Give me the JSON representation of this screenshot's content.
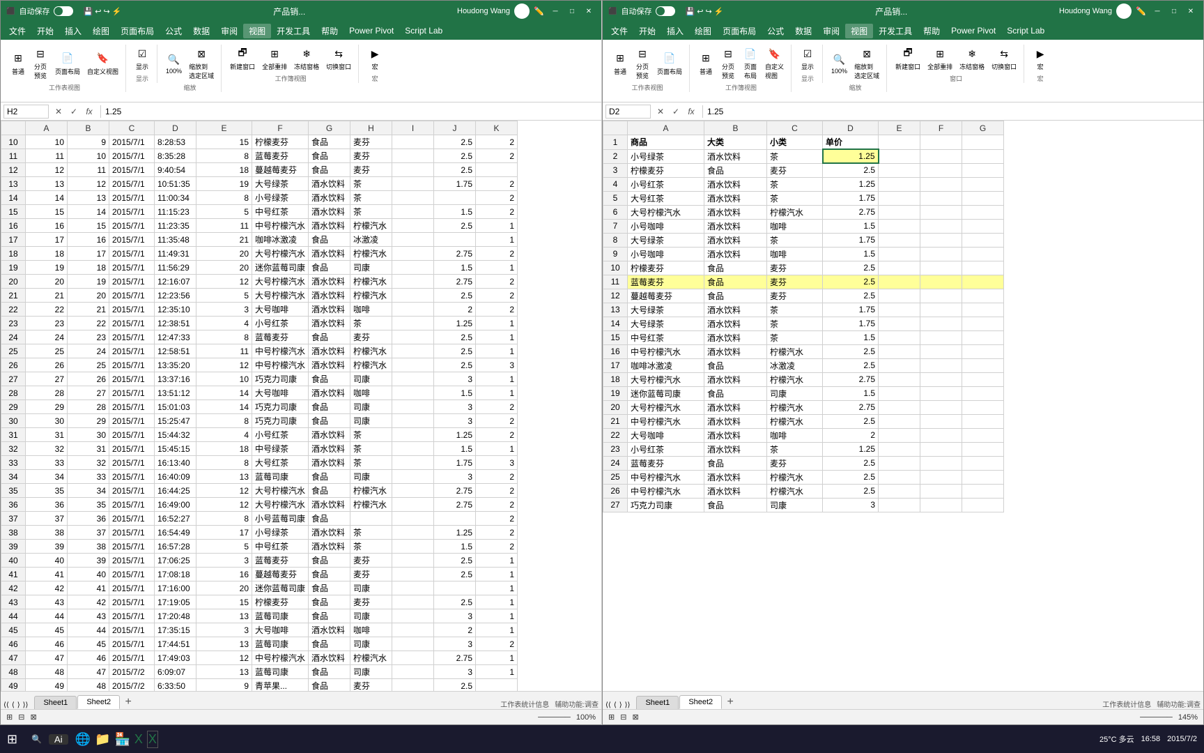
{
  "windows": [
    {
      "id": "left",
      "titleBar": {
        "autosave": "自动保存",
        "title": "产品销...",
        "user": "Houdong Wang",
        "controls": [
          "─",
          "□",
          "✕"
        ]
      },
      "menuItems": [
        "文件",
        "开始",
        "插入",
        "绘图",
        "页面布局",
        "公式",
        "数据",
        "审阅",
        "视图",
        "开发工具",
        "帮助",
        "Power Pivot",
        "Script Lab"
      ],
      "activeMenu": "视图",
      "ribbonGroups": [
        {
          "label": "工作表视图",
          "btns": [
            "普通",
            "分页预览",
            "页面布局",
            "自定义视图"
          ]
        },
        {
          "label": "显示",
          "btns": [
            "显示"
          ]
        },
        {
          "label": "缩放",
          "btns": [
            "100%",
            "缩放到选定区域"
          ]
        },
        {
          "label": "窗口",
          "btns": [
            "新建窗口",
            "全部重排",
            "冻结窗格",
            "切换窗口"
          ]
        },
        {
          "label": "宏",
          "btns": [
            "宏"
          ]
        }
      ],
      "formulaBar": {
        "cellRef": "H2",
        "formula": "1.25"
      },
      "columns": [
        "",
        "A",
        "B",
        "C",
        "D",
        "E",
        "F",
        "G",
        "H",
        "I",
        "J",
        "K"
      ],
      "rows": [
        [
          "10",
          "9",
          "2015/7/1",
          "8:28:53",
          "15",
          "柠檬麦芬",
          "食品",
          "",
          "麦芬",
          "",
          "2.5",
          "2"
        ],
        [
          "11",
          "10",
          "2015/7/1",
          "8:35:28",
          "8",
          "蓝莓麦芬",
          "食品",
          "",
          "麦芬",
          "",
          "2.5",
          "2"
        ],
        [
          "12",
          "11",
          "2015/7/1",
          "9:40:54",
          "18",
          "蔓越莓麦芬",
          "食品",
          "",
          "麦芬",
          "",
          "2.5",
          ""
        ],
        [
          "13",
          "12",
          "2015/7/1",
          "10:51:35",
          "19",
          "大号绿茶",
          "酒水饮料",
          "",
          "茶",
          "",
          "1.75",
          "2"
        ],
        [
          "14",
          "13",
          "2015/7/1",
          "11:00:34",
          "8",
          "小号绿茶",
          "酒水饮料",
          "",
          "茶",
          "",
          "",
          "2"
        ],
        [
          "15",
          "14",
          "2015/7/1",
          "11:15:23",
          "5",
          "中号红茶",
          "酒水饮料",
          "",
          "茶",
          "",
          "1.5",
          "2"
        ],
        [
          "16",
          "15",
          "2015/7/1",
          "11:23:35",
          "11",
          "中号柠檬汽水",
          "酒水饮料",
          "",
          "柠檬汽水",
          "",
          "2.5",
          "1"
        ],
        [
          "17",
          "16",
          "2015/7/1",
          "11:35:48",
          "21",
          "咖啡冰激凌",
          "食品",
          "",
          "冰激凌",
          "",
          "",
          "1"
        ],
        [
          "18",
          "17",
          "2015/7/1",
          "11:49:31",
          "20",
          "大号柠檬汽水",
          "酒水饮料",
          "",
          "柠檬汽水",
          "",
          "2.75",
          "2"
        ],
        [
          "19",
          "18",
          "2015/7/1",
          "11:56:29",
          "20",
          "迷你蓝莓司康",
          "食品",
          "",
          "司康",
          "",
          "1.5",
          "1"
        ],
        [
          "20",
          "19",
          "2015/7/1",
          "12:16:07",
          "12",
          "大号柠檬汽水",
          "酒水饮料",
          "",
          "柠檬汽水",
          "",
          "2.75",
          "2"
        ],
        [
          "21",
          "20",
          "2015/7/1",
          "12:23:56",
          "5",
          "大号柠檬汽水",
          "酒水饮料",
          "",
          "柠檬汽水",
          "",
          "2.5",
          "2"
        ],
        [
          "22",
          "21",
          "2015/7/1",
          "12:35:10",
          "3",
          "大号咖啡",
          "酒水饮料",
          "",
          "咖啡",
          "",
          "2",
          "2"
        ],
        [
          "23",
          "22",
          "2015/7/1",
          "12:38:51",
          "4",
          "小号红茶",
          "酒水饮料",
          "",
          "茶",
          "",
          "1.25",
          "1"
        ],
        [
          "24",
          "23",
          "2015/7/1",
          "12:47:33",
          "8",
          "蓝莓麦芬",
          "食品",
          "",
          "麦芬",
          "",
          "2.5",
          "1"
        ],
        [
          "25",
          "24",
          "2015/7/1",
          "12:58:51",
          "11",
          "中号柠檬汽水",
          "酒水饮料",
          "",
          "柠檬汽水",
          "",
          "2.5",
          "1"
        ],
        [
          "26",
          "25",
          "2015/7/1",
          "13:35:20",
          "12",
          "中号柠檬汽水",
          "酒水饮料",
          "",
          "柠檬汽水",
          "",
          "2.5",
          "3"
        ],
        [
          "27",
          "26",
          "2015/7/1",
          "13:37:16",
          "10",
          "巧克力司康",
          "食品",
          "",
          "司康",
          "",
          "3",
          "1"
        ],
        [
          "28",
          "27",
          "2015/7/1",
          "13:51:12",
          "14",
          "大号咖啡",
          "酒水饮料",
          "",
          "咖啡",
          "",
          "1.5",
          "1"
        ],
        [
          "29",
          "28",
          "2015/7/1",
          "15:01:03",
          "14",
          "巧克力司康",
          "食品",
          "",
          "司康",
          "",
          "3",
          "2"
        ],
        [
          "30",
          "29",
          "2015/7/1",
          "15:25:47",
          "8",
          "巧克力司康",
          "食品",
          "",
          "司康",
          "",
          "3",
          "2"
        ],
        [
          "31",
          "30",
          "2015/7/1",
          "15:44:32",
          "4",
          "小号红茶",
          "酒水饮料",
          "",
          "茶",
          "",
          "1.25",
          "2"
        ],
        [
          "32",
          "31",
          "2015/7/1",
          "15:45:15",
          "18",
          "中号绿茶",
          "酒水饮料",
          "",
          "茶",
          "",
          "1.5",
          "1"
        ],
        [
          "33",
          "32",
          "2015/7/1",
          "16:13:40",
          "8",
          "大号红茶",
          "酒水饮料",
          "",
          "茶",
          "",
          "1.75",
          "3"
        ],
        [
          "34",
          "33",
          "2015/7/1",
          "16:40:09",
          "13",
          "蓝莓司康",
          "食品",
          "",
          "司康",
          "",
          "3",
          "2"
        ],
        [
          "35",
          "34",
          "2015/7/1",
          "16:44:25",
          "12",
          "大号柠檬汽水",
          "食品",
          "",
          "柠檬汽水",
          "",
          "2.75",
          "2"
        ],
        [
          "36",
          "35",
          "2015/7/1",
          "16:49:00",
          "12",
          "大号柠檬汽水",
          "酒水饮料",
          "",
          "柠檬汽水",
          "",
          "2.75",
          "2"
        ],
        [
          "37",
          "36",
          "2015/7/1",
          "16:52:27",
          "8",
          "小号蓝莓司康",
          "食品",
          "",
          "",
          "",
          "",
          "2"
        ],
        [
          "38",
          "37",
          "2015/7/1",
          "16:54:49",
          "17",
          "小号绿茶",
          "酒水饮料",
          "",
          "茶",
          "",
          "1.25",
          "2"
        ],
        [
          "39",
          "38",
          "2015/7/1",
          "16:57:28",
          "5",
          "中号红茶",
          "酒水饮料",
          "",
          "茶",
          "",
          "1.5",
          "2"
        ],
        [
          "40",
          "39",
          "2015/7/1",
          "17:06:25",
          "3",
          "蓝莓麦芬",
          "食品",
          "",
          "麦芬",
          "",
          "2.5",
          "1"
        ],
        [
          "41",
          "40",
          "2015/7/1",
          "17:08:18",
          "16",
          "蔓越莓麦芬",
          "食品",
          "",
          "麦芬",
          "",
          "2.5",
          "1"
        ],
        [
          "42",
          "41",
          "2015/7/1",
          "17:16:00",
          "20",
          "迷你蓝莓司康",
          "食品",
          "",
          "司康",
          "",
          "",
          "1"
        ],
        [
          "43",
          "42",
          "2015/7/1",
          "17:19:05",
          "15",
          "柠檬麦芬",
          "食品",
          "",
          "麦芬",
          "",
          "2.5",
          "1"
        ],
        [
          "44",
          "43",
          "2015/7/1",
          "17:20:48",
          "13",
          "蓝莓司康",
          "食品",
          "",
          "司康",
          "",
          "3",
          "1"
        ],
        [
          "45",
          "44",
          "2015/7/1",
          "17:35:15",
          "3",
          "大号咖啡",
          "酒水饮料",
          "",
          "咖啡",
          "",
          "2",
          "1"
        ],
        [
          "46",
          "45",
          "2015/7/1",
          "17:44:51",
          "13",
          "蓝莓司康",
          "食品",
          "",
          "司康",
          "",
          "3",
          "2"
        ],
        [
          "47",
          "46",
          "2015/7/1",
          "17:49:03",
          "12",
          "中号柠檬汽水",
          "酒水饮料",
          "",
          "柠檬汽水",
          "",
          "2.75",
          "1"
        ],
        [
          "48",
          "47",
          "2015/7/2",
          "6:09:07",
          "13",
          "蓝莓司康",
          "食品",
          "",
          "司康",
          "",
          "3",
          "1"
        ],
        [
          "49",
          "48",
          "2015/7/2",
          "6:33:50",
          "9",
          "青苹果...",
          "食品",
          "",
          "麦芬",
          "",
          "2.5",
          ""
        ]
      ],
      "sheetTabs": [
        "Sheet1",
        "Sheet2"
      ],
      "activeSheet": "Sheet2",
      "statusLeft": "工作表统计信息",
      "statusRight": "辅助功能:调查",
      "zoom": "100%"
    },
    {
      "id": "right",
      "titleBar": {
        "autosave": "自动保存",
        "title": "产品销...",
        "user": "Houdong Wang",
        "controls": [
          "─",
          "□",
          "✕"
        ]
      },
      "menuItems": [
        "文件",
        "开始",
        "插入",
        "绘图",
        "页面布局",
        "公式",
        "数据",
        "审阅",
        "视图",
        "开发工具",
        "帮助",
        "Power Pivot",
        "Script Lab"
      ],
      "activeMenu": "视图",
      "formulaBar": {
        "cellRef": "D2",
        "formula": "1.25"
      },
      "columns": [
        "",
        "A",
        "B",
        "C",
        "D",
        "E",
        "F",
        "G"
      ],
      "headers": [
        "商品",
        "大类",
        "小类",
        "单价"
      ],
      "rows": [
        [
          "2",
          "小号绿茶",
          "酒水饮料",
          "茶",
          "1.25",
          "",
          "",
          ""
        ],
        [
          "3",
          "柠檬麦芬",
          "食品",
          "麦芬",
          "2.5",
          "",
          "",
          ""
        ],
        [
          "4",
          "小号红茶",
          "酒水饮料",
          "茶",
          "1.25",
          "",
          "",
          ""
        ],
        [
          "5",
          "大号红茶",
          "酒水饮料",
          "茶",
          "1.75",
          "",
          "",
          ""
        ],
        [
          "6",
          "大号柠檬汽水",
          "酒水饮料",
          "柠檬汽水",
          "2.75",
          "",
          "",
          ""
        ],
        [
          "7",
          "小号咖啡",
          "酒水饮料",
          "咖啡",
          "1.5",
          "",
          "",
          ""
        ],
        [
          "8",
          "大号绿茶",
          "酒水饮料",
          "茶",
          "1.75",
          "",
          "",
          ""
        ],
        [
          "9",
          "小号咖啡",
          "酒水饮料",
          "咖啡",
          "1.5",
          "",
          "",
          ""
        ],
        [
          "10",
          "柠檬麦芬",
          "食品",
          "麦芬",
          "2.5",
          "",
          "",
          ""
        ],
        [
          "11",
          "蓝莓麦芬",
          "食品",
          "麦芬",
          "2.5",
          "",
          "",
          ""
        ],
        [
          "12",
          "蔓越莓麦芬",
          "食品",
          "麦芬",
          "2.5",
          "",
          "",
          ""
        ],
        [
          "13",
          "大号绿茶",
          "酒水饮料",
          "茶",
          "1.75",
          "",
          "",
          ""
        ],
        [
          "14",
          "大号绿茶",
          "酒水饮料",
          "茶",
          "1.75",
          "",
          "",
          ""
        ],
        [
          "15",
          "中号红茶",
          "酒水饮料",
          "茶",
          "1.5",
          "",
          "",
          ""
        ],
        [
          "16",
          "中号柠檬汽水",
          "酒水饮料",
          "柠檬汽水",
          "2.5",
          "",
          "",
          ""
        ],
        [
          "17",
          "咖啡冰激凌",
          "食品",
          "冰激凌",
          "2.5",
          "",
          "",
          ""
        ],
        [
          "18",
          "大号柠檬汽水",
          "酒水饮料",
          "柠檬汽水",
          "2.75",
          "",
          "",
          ""
        ],
        [
          "19",
          "迷你蓝莓司康",
          "食品",
          "司康",
          "1.5",
          "",
          "",
          ""
        ],
        [
          "20",
          "大号柠檬汽水",
          "酒水饮料",
          "柠檬汽水",
          "2.75",
          "",
          "",
          ""
        ],
        [
          "21",
          "中号柠檬汽水",
          "酒水饮料",
          "柠檬汽水",
          "2.5",
          "",
          "",
          ""
        ],
        [
          "22",
          "大号咖啡",
          "酒水饮料",
          "咖啡",
          "2",
          "",
          "",
          ""
        ],
        [
          "23",
          "小号红茶",
          "酒水饮料",
          "茶",
          "1.25",
          "",
          "",
          ""
        ],
        [
          "24",
          "蓝莓麦芬",
          "食品",
          "麦芬",
          "2.5",
          "",
          "",
          ""
        ],
        [
          "25",
          "中号柠檬汽水",
          "酒水饮料",
          "柠檬汽水",
          "2.5",
          "",
          "",
          ""
        ],
        [
          "26",
          "中号柠檬汽水",
          "酒水饮料",
          "柠檬汽水",
          "2.5",
          "",
          "",
          ""
        ],
        [
          "27",
          "巧克力司康",
          "食品",
          "司康",
          "3",
          "",
          "",
          ""
        ]
      ],
      "sheetTabs": [
        "Sheet1",
        "Sheet2"
      ],
      "activeSheet": "Sheet2",
      "statusLeft": "工作表统计信息",
      "statusRight": "辅助功能:调查",
      "zoom": "145%",
      "highlightedRow": 11
    }
  ],
  "taskbar": {
    "startBtn": "⊞",
    "aiLabel": "Ai",
    "time": "16:58",
    "date": "2015/7/2",
    "systemInfo": "25°C 多云"
  }
}
